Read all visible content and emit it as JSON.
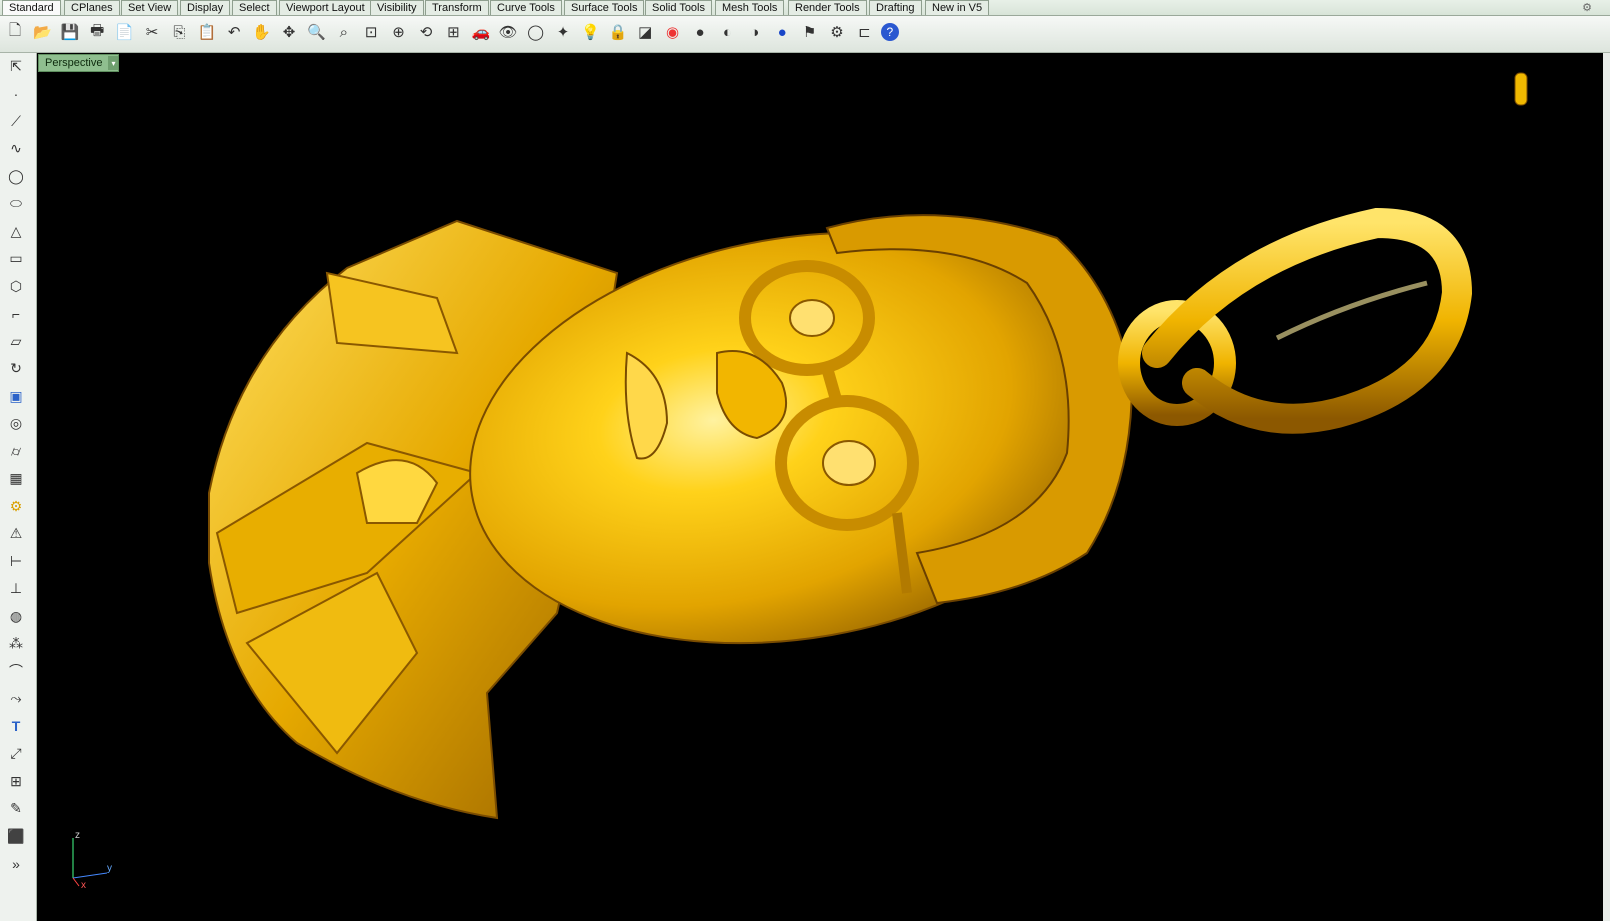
{
  "tabs": [
    {
      "label": "Standard",
      "active": true
    },
    {
      "label": "CPlanes"
    },
    {
      "label": "Set View"
    },
    {
      "label": "Display"
    },
    {
      "label": "Select"
    },
    {
      "label": "Viewport Layout"
    },
    {
      "label": "Visibility"
    },
    {
      "label": "Transform"
    },
    {
      "label": "Curve Tools"
    },
    {
      "label": "Surface Tools"
    },
    {
      "label": "Solid Tools"
    },
    {
      "label": "Mesh Tools"
    },
    {
      "label": "Render Tools"
    },
    {
      "label": "Drafting"
    },
    {
      "label": "New in V5"
    }
  ],
  "toolbar_icons": [
    "new-icon",
    "open-icon",
    "save-icon",
    "print-icon",
    "import-icon",
    "cut-icon",
    "copy-icon",
    "paste-icon",
    "undo-icon",
    "pan-icon",
    "rotate-view-icon",
    "zoom-icon",
    "zoom-window-icon",
    "zoom-extents-icon",
    "zoom-selected-icon",
    "undo-view-icon",
    "four-viewports-icon",
    "car-icon",
    "hide-icon",
    "circle-icon",
    "lights-icon",
    "bulb-icon",
    "lock-icon",
    "layer-icon",
    "color-wheel-icon",
    "shaded-sphere-icon",
    "rendered-sphere-icon",
    "grey-sphere-icon",
    "blue-sphere-icon",
    "snap-icon",
    "settings-gear-icon",
    "dimension-icon",
    "help-icon"
  ],
  "sidebar_icons": [
    "select-arrow-icon",
    "point-icon",
    "polyline-icon",
    "curve-icon",
    "circle-icon",
    "ellipse-icon",
    "polygon-icon",
    "rectangle-icon",
    "hexagon-icon",
    "fillet-icon",
    "surface-icon",
    "sweep-icon",
    "box-icon",
    "solid-union-icon",
    "cylinder-icon",
    "mesh-plane-icon",
    "gear-icon",
    "analyze-icon",
    "dimension-icon",
    "align-icon",
    "boolean-icon",
    "group-icon",
    "arc-icon",
    "offset-icon",
    "text-icon",
    "transform-icon",
    "array-icon",
    "edit-icon",
    "cube-icon",
    "more-icon"
  ],
  "viewport": {
    "label": "Perspective",
    "dropdown": "▾"
  },
  "axes": {
    "z": "z",
    "y": "y",
    "x": "x"
  },
  "gear_glyph": "⚙",
  "more_glyph": "»",
  "colors": {
    "model_gold": "#f0b800",
    "viewport_bg": "#000000",
    "label_green": "#8fbf8f"
  }
}
